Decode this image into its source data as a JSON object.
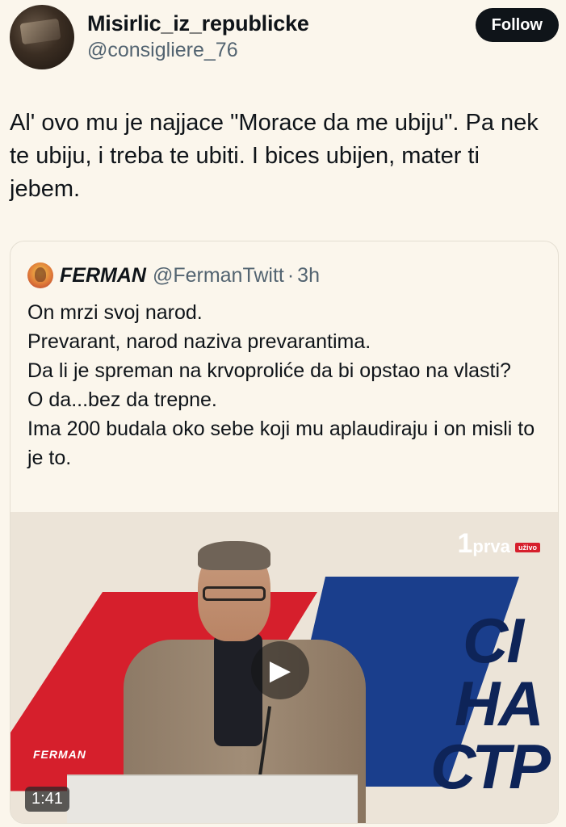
{
  "author": {
    "name": "Misirlic_iz_republicke",
    "handle": "@consigliere_76",
    "avatar_icon": "avatar-photo"
  },
  "follow_label": "Follow",
  "tweet_text": "Al' ovo mu je najjace \"Morace da me ubiju\". Pa nek te ubiju, i treba te ubiti. I bices ubijen, mater ti jebem.",
  "quoted": {
    "name": "FERMAN",
    "handle": "@FermanTwitt",
    "separator": "·",
    "time": "3h",
    "lines": [
      "On mrzi svoj narod.",
      "Prevarant, narod naziva prevarantima.",
      "Da li je spreman na krvoproliće da bi opstao na vlasti?",
      "O da...bez da trepne.",
      "Ima 200 budala oko sebe koji mu aplaudiraju i on misli to je to."
    ],
    "video": {
      "channel_logo_number": "1",
      "channel_logo_text": "prva",
      "channel_live": "uživo",
      "watermark": "FERMAN",
      "duration": "1:41",
      "slogan_lines": [
        "СІ",
        "НА",
        "СТР"
      ],
      "play_icon": "play-icon"
    }
  },
  "colors": {
    "background": "#fbf6ec",
    "follow_button": "#0f1419",
    "secondary_text": "#536471"
  }
}
